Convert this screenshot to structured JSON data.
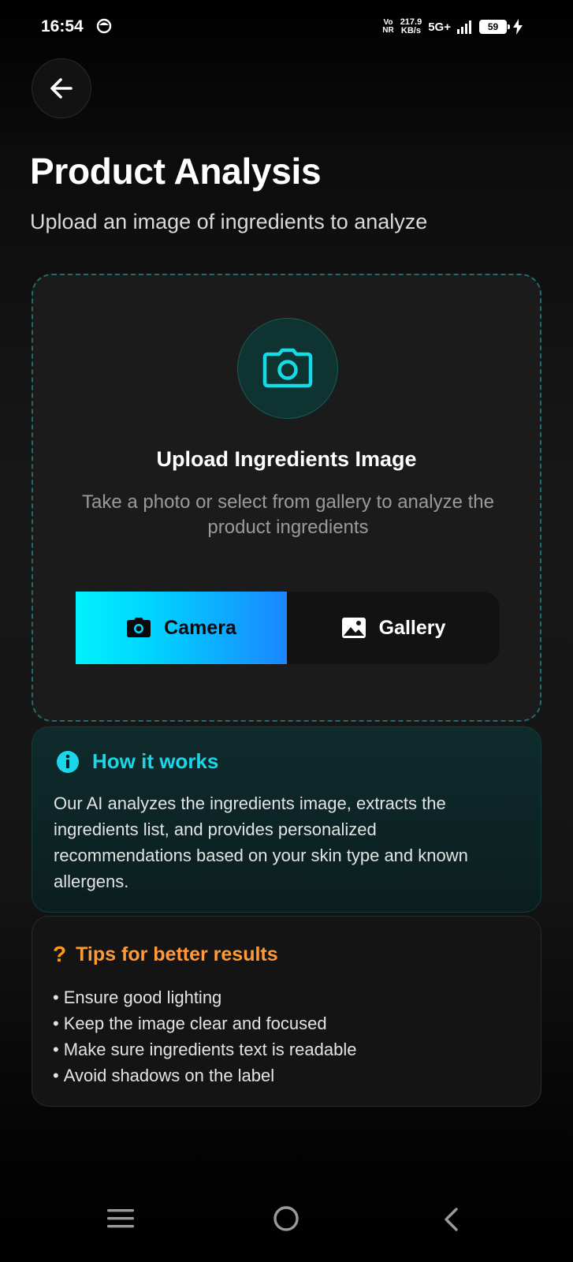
{
  "status_bar": {
    "time": "16:54",
    "network_label_top": "Vo",
    "network_label_bottom": "NR",
    "speed_value": "217.9",
    "speed_unit": "KB/s",
    "network_type": "5G+",
    "battery": "59"
  },
  "header": {
    "back_icon": "arrow-left-icon",
    "title": "Product Analysis",
    "subtitle": "Upload an image of ingredients to analyze"
  },
  "upload": {
    "icon": "camera-icon",
    "title": "Upload Ingredients Image",
    "description": "Take a photo or select from gallery to analyze the product ingredients",
    "camera_button": {
      "label": "Camera",
      "icon": "camera-icon"
    },
    "gallery_button": {
      "label": "Gallery",
      "icon": "image-icon"
    }
  },
  "how_it_works": {
    "icon": "info-icon",
    "title": "How it works",
    "body": "Our AI analyzes the ingredients image, extracts the ingredients list, and provides personalized recommendations based on your skin type and known allergens."
  },
  "tips": {
    "icon_glyph": "?",
    "title": "Tips for better results",
    "items": [
      "Ensure good lighting",
      "Keep the image clear and focused",
      "Make sure ingredients text is readable",
      "Avoid shadows on the label"
    ]
  },
  "colors": {
    "accent_cyan": "#19d6ea",
    "accent_orange": "#ff9a3a",
    "button_gradient_start": "#00f2fe",
    "button_gradient_end": "#1a86ff"
  },
  "nav": {
    "menu_icon": "menu-icon",
    "home_icon": "home-circle-icon",
    "back_icon": "back-chevron-icon"
  }
}
